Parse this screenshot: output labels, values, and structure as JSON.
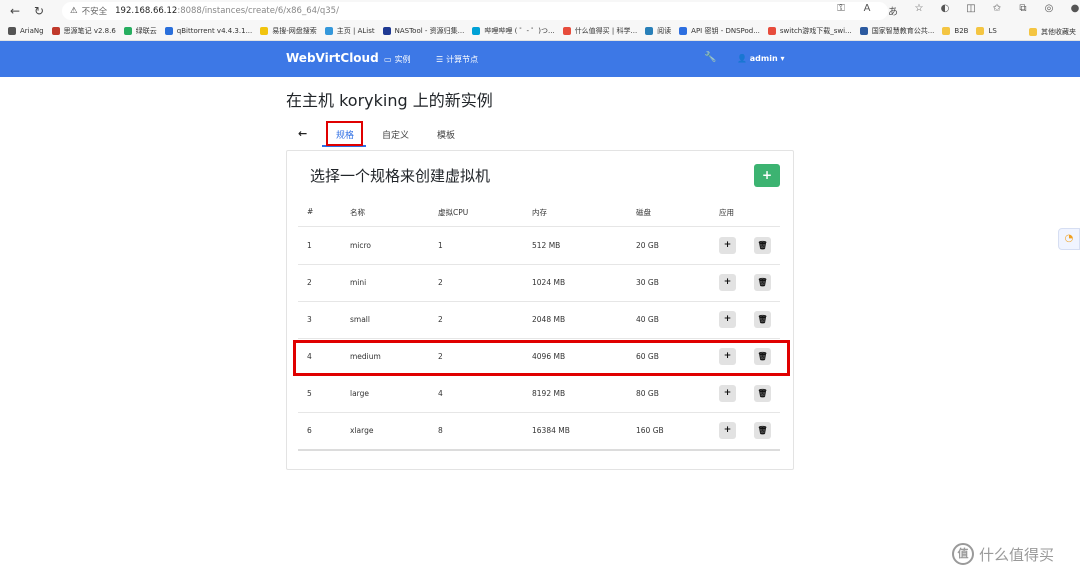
{
  "browser": {
    "insecure_label": "不安全",
    "url_host": "192.168.66.12",
    "url_path": ":8088/instances/create/6/x86_64/q35/",
    "bookmarks": [
      {
        "label": "AriaNg",
        "color": "#555555"
      },
      {
        "label": "思源笔记 v2.8.6",
        "color": "#c0392b"
      },
      {
        "label": "绿联云",
        "color": "#27ae60"
      },
      {
        "label": "qBittorrent v4.4.3.1...",
        "color": "#2a6fdb"
      },
      {
        "label": "易搜-网盘搜索",
        "color": "#f1c40f"
      },
      {
        "label": "主页 | AList",
        "color": "#3498db"
      },
      {
        "label": "NASTool - 资源归集...",
        "color": "#1f3a93"
      },
      {
        "label": "哔哩哔哩 ( ゜- ゜)つ...",
        "color": "#00a1d6"
      },
      {
        "label": "什么值得买 | 科学...",
        "color": "#e74c3c"
      },
      {
        "label": "阅读",
        "color": "#2980b9"
      },
      {
        "label": "API 密钥 - DNSPod...",
        "color": "#2d6fe0"
      },
      {
        "label": "switch游戏下载_swi...",
        "color": "#e74c3c"
      },
      {
        "label": "国家智慧教育公共...",
        "color": "#2c5aa0"
      },
      {
        "label": "B2B",
        "color": "#f4c542"
      },
      {
        "label": "LS",
        "color": "#f4c542"
      }
    ],
    "other_bookmarks": "其他收藏夹"
  },
  "navbar": {
    "brand": "WebVirtCloud",
    "links": [
      {
        "label": "实例",
        "icon": "monitor-icon"
      },
      {
        "label": "计算节点",
        "icon": "server-icon"
      }
    ],
    "user": "admin"
  },
  "page": {
    "title": "在主机 koryking 上的新实例",
    "tabs": [
      "规格",
      "自定义",
      "模板"
    ],
    "active_tab": "规格",
    "card_title": "选择一个规格来创建虚拟机"
  },
  "table": {
    "headers": [
      "#",
      "名称",
      "虚拟CPU",
      "内存",
      "磁盘",
      "应用"
    ],
    "rows": [
      [
        "1",
        "micro",
        "1",
        "512 MB",
        "20 GB"
      ],
      [
        "2",
        "mini",
        "2",
        "1024 MB",
        "30 GB"
      ],
      [
        "3",
        "small",
        "2",
        "2048 MB",
        "40 GB"
      ],
      [
        "4",
        "medium",
        "2",
        "4096 MB",
        "60 GB"
      ],
      [
        "5",
        "large",
        "4",
        "8192 MB",
        "80 GB"
      ],
      [
        "6",
        "xlarge",
        "8",
        "16384 MB",
        "160 GB"
      ]
    ],
    "highlighted_row": 4
  },
  "watermark": "什么值得买",
  "colors": {
    "navbar": "#3d78e6",
    "accent": "#2f6fe4",
    "add_button": "#3cb371",
    "highlight": "#e00000"
  }
}
